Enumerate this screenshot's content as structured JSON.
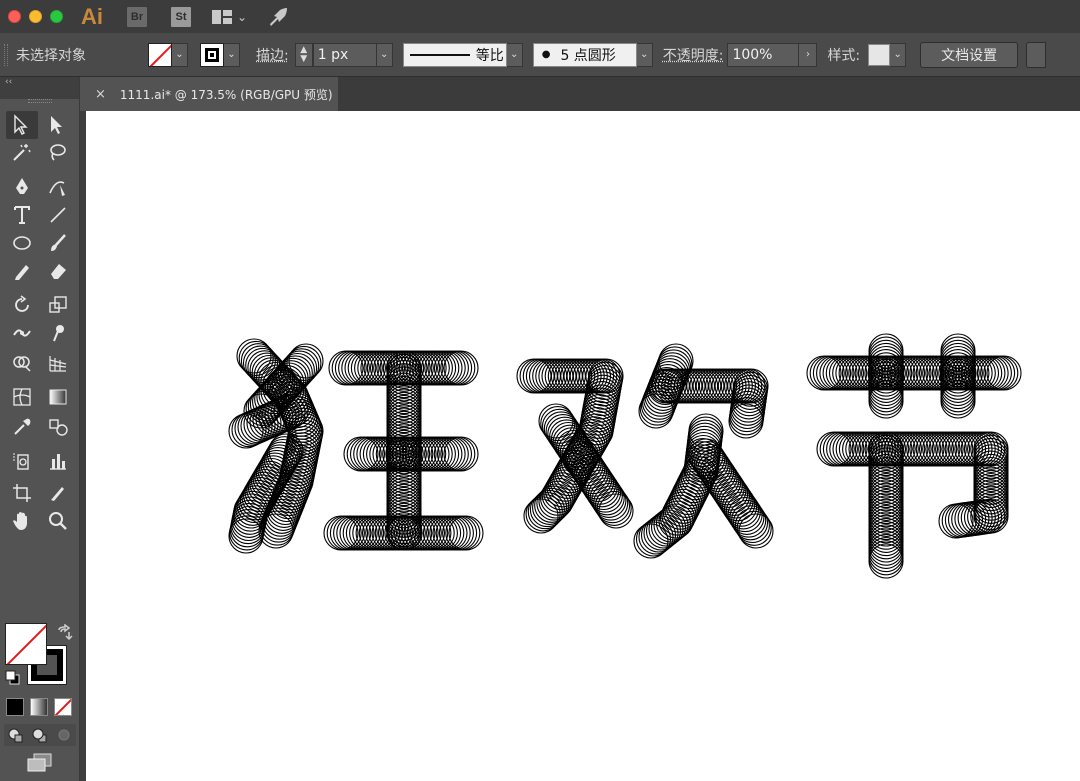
{
  "titlebar": {
    "app_logo": "Ai",
    "bridge_label": "Br",
    "stock_label": "St",
    "layout_icon": "layout-grid-icon",
    "send_icon": "rocket-icon",
    "layout_chevron": "⌄"
  },
  "controlbar": {
    "selection_status": "未选择对象",
    "stroke_label": "描边:",
    "stroke_weight": "1 px",
    "profile_label": "等比",
    "brush_label": "5 点圆形",
    "opacity_label": "不透明度:",
    "opacity_value": "100%",
    "opacity_arrow": "›",
    "style_label": "样式:",
    "doc_setup_button": "文档设置",
    "chevron": "⌄"
  },
  "document": {
    "tab_close": "×",
    "tab_title": "1111.ai* @ 173.5% (RGB/GPU 预览)"
  },
  "toolbox": {
    "collapse_arrows": "‹‹",
    "tools": [
      "selection-tool-icon",
      "direct-selection-tool-icon",
      "magic-wand-tool-icon",
      "lasso-tool-icon",
      "pen-tool-icon",
      "curvature-tool-icon",
      "type-tool-icon",
      "line-segment-tool-icon",
      "ellipse-tool-icon",
      "paintbrush-tool-icon",
      "pencil-tool-icon",
      "eraser-tool-icon",
      "rotate-tool-icon",
      "scale-tool-icon",
      "width-tool-icon",
      "puppet-warp-tool-icon",
      "shape-builder-tool-icon",
      "perspective-grid-tool-icon",
      "mesh-tool-icon",
      "gradient-tool-icon",
      "eyedropper-tool-icon",
      "blend-tool-icon",
      "symbol-sprayer-tool-icon",
      "column-graph-tool-icon",
      "artboard-tool-icon",
      "slice-tool-icon",
      "hand-tool-icon",
      "zoom-tool-icon"
    ]
  },
  "artwork": {
    "text": "狂欢节",
    "stroke_color": "#000000",
    "fill_color": "none"
  },
  "colors": {
    "accent_none_slash": "#e01b1b",
    "panel_bg": "#535353",
    "title_bg": "#3c3c3c"
  }
}
